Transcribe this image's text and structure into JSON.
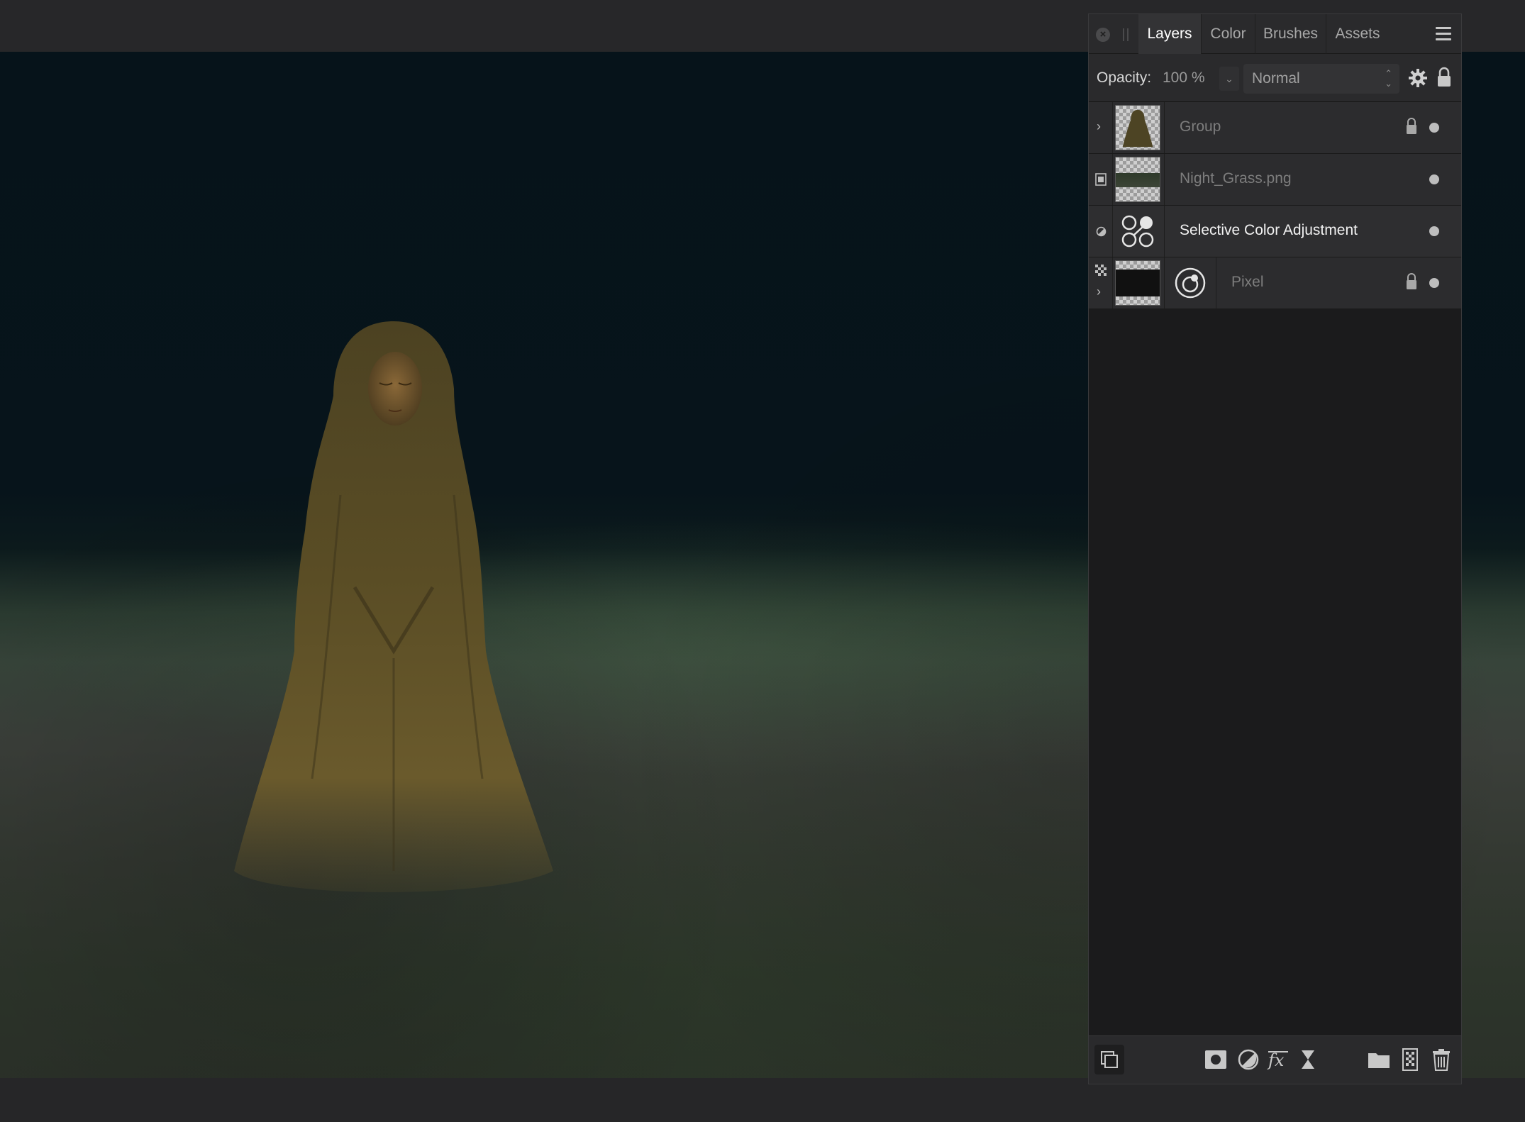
{
  "panel": {
    "tabs": [
      {
        "label": "Layers",
        "active": true
      },
      {
        "label": "Color",
        "active": false
      },
      {
        "label": "Brushes",
        "active": false
      },
      {
        "label": "Assets",
        "active": false
      }
    ],
    "opacity_label": "Opacity:",
    "opacity_value": "100 %",
    "blend_mode": "Normal",
    "layers": [
      {
        "name": "Group",
        "type": "group",
        "locked": true,
        "visible": true
      },
      {
        "name": "Night_Grass.png",
        "type": "image",
        "locked": false,
        "visible": true
      },
      {
        "name": "Selective Color Adjustment",
        "type": "adjustment",
        "locked": false,
        "visible": true,
        "selected": true
      },
      {
        "name": "Pixel",
        "type": "pixel",
        "locked": true,
        "visible": true
      }
    ],
    "footer_icons": [
      "layer-stack-icon",
      "mask-icon",
      "adjustment-icon",
      "fx-icon",
      "live-filter-icon",
      "folder-icon",
      "pixel-layer-icon",
      "trash-icon"
    ]
  },
  "colors": {
    "accent_text": "#ffffff",
    "panel_bg": "#1b1b1c",
    "row_bg": "#2c2c2e"
  }
}
